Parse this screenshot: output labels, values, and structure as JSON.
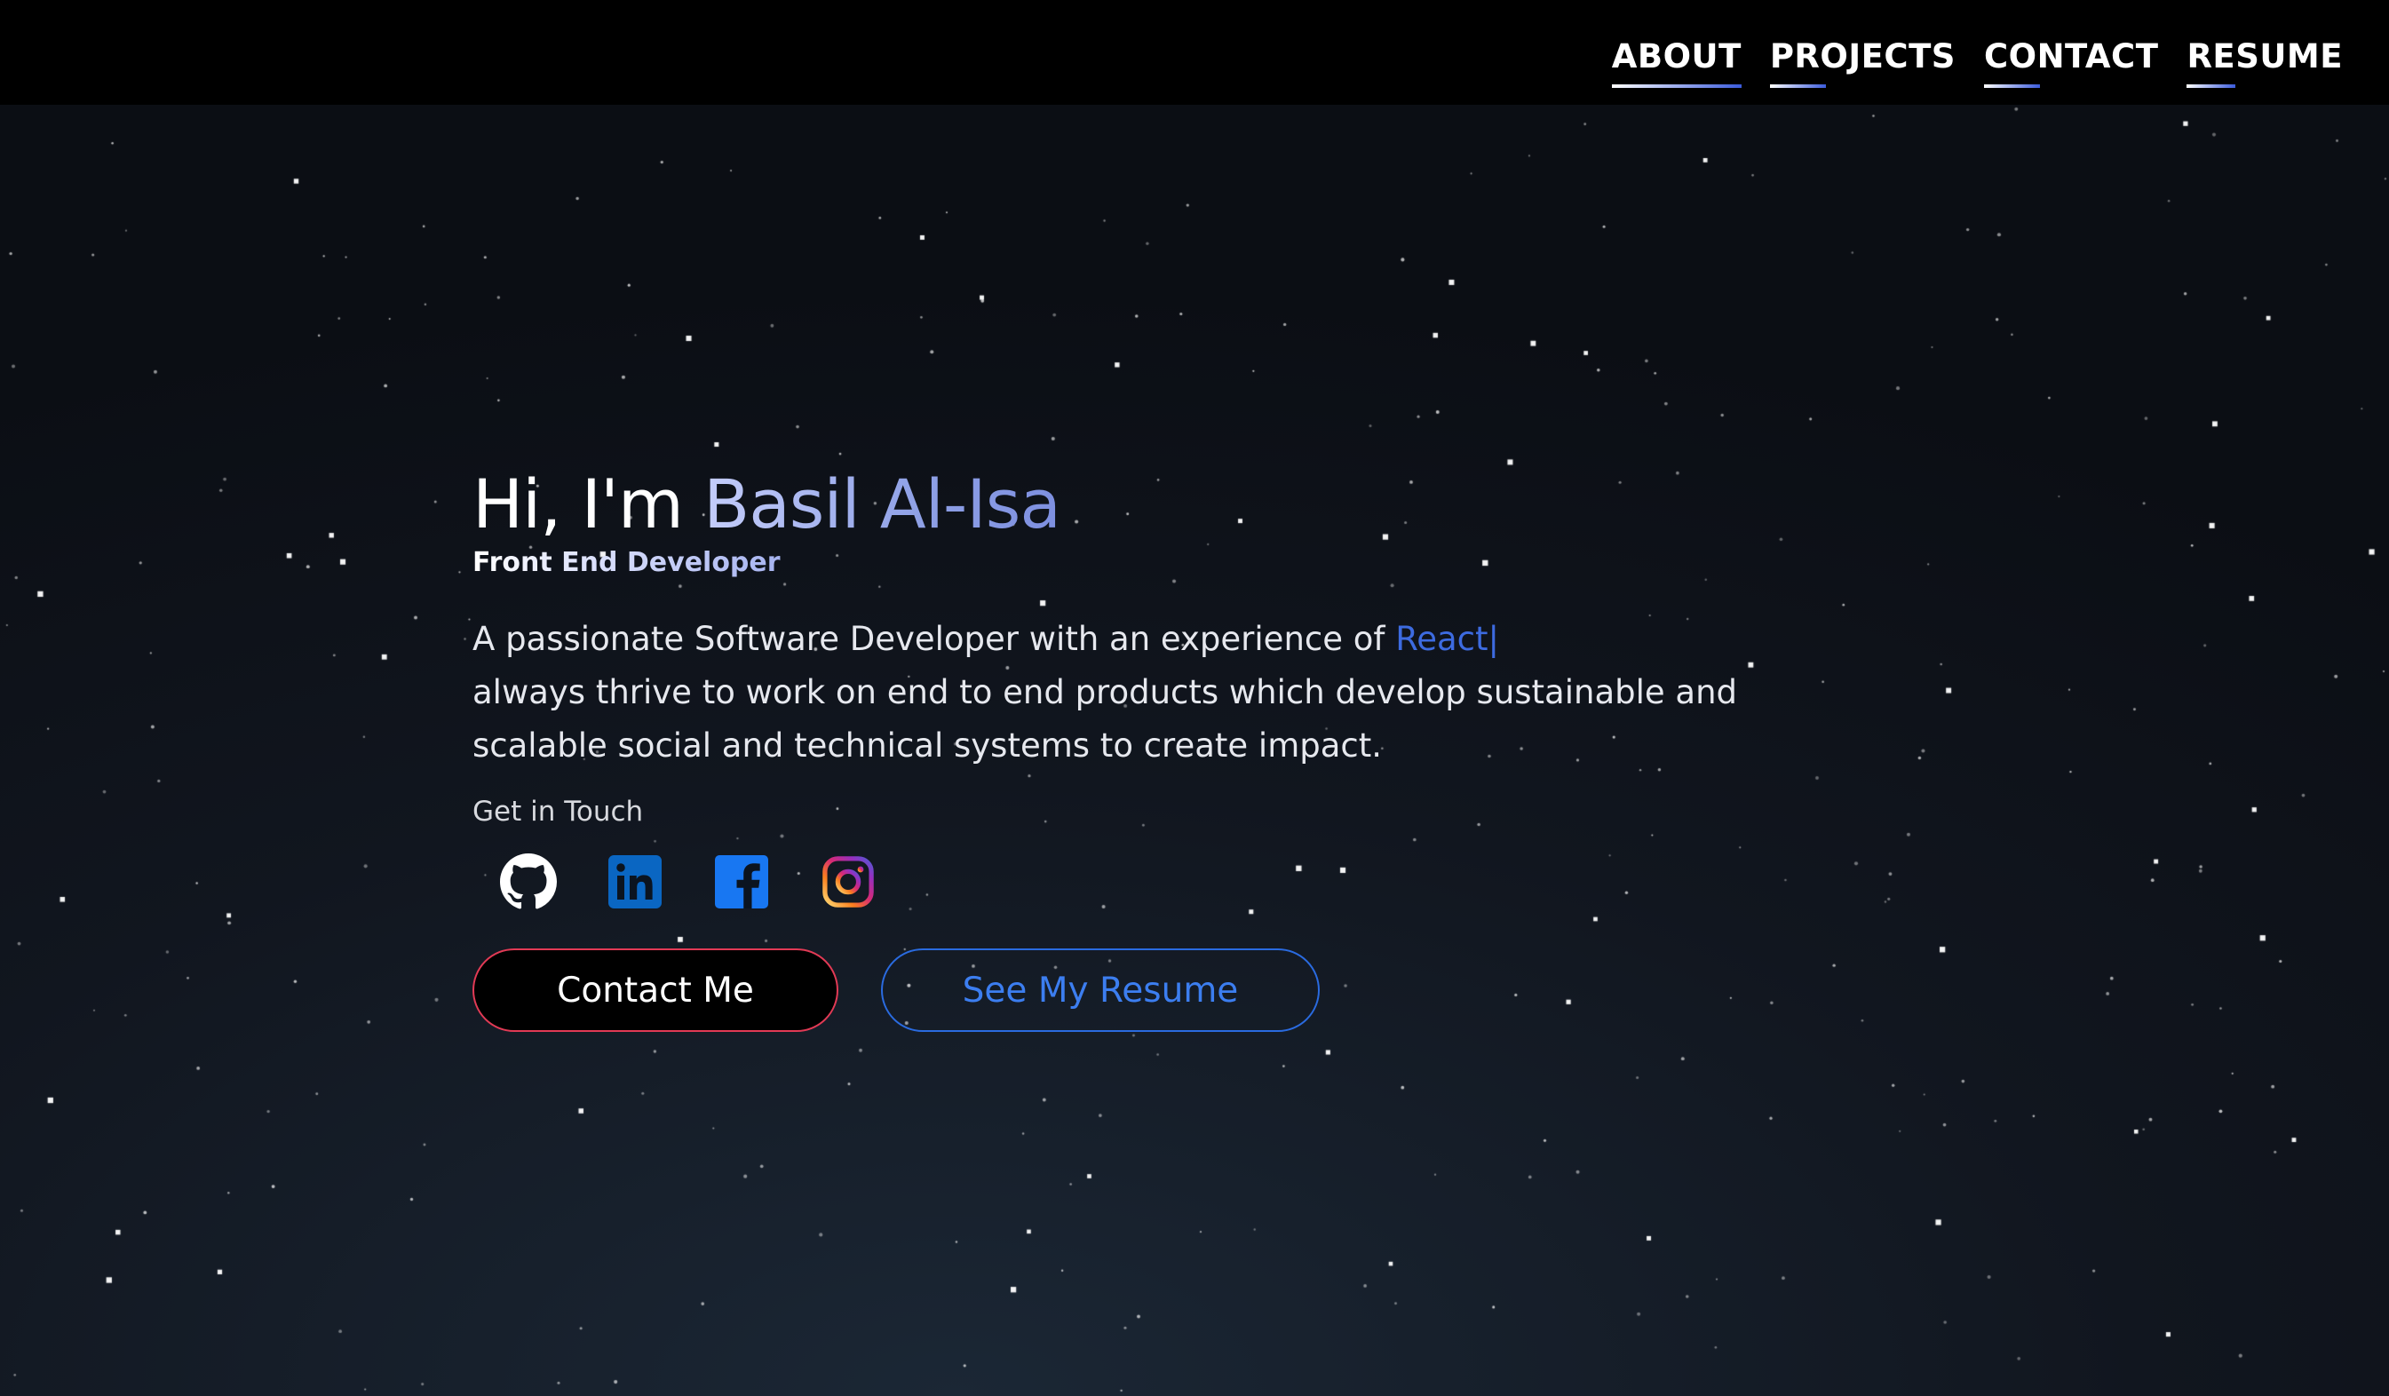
{
  "nav": {
    "items": [
      {
        "label": "ABOUT"
      },
      {
        "label": "PROJECTS"
      },
      {
        "label": "CONTACT"
      },
      {
        "label": "RESUME"
      }
    ]
  },
  "hero": {
    "greeting_prefix": "Hi, I'm ",
    "name": "Basil Al-Isa",
    "role": "Front End Developer",
    "description_prefix": "A passionate Software Developer with an experience of ",
    "typed_word": "React",
    "cursor": "|",
    "description_rest": "always thrive to work on end to end products which develop sustainable and scalable social and technical systems to create impact.",
    "get_in_touch": "Get in Touch"
  },
  "socials": [
    {
      "icon": "github-icon"
    },
    {
      "icon": "linkedin-icon"
    },
    {
      "icon": "facebook-icon"
    },
    {
      "icon": "instagram-icon"
    }
  ],
  "buttons": {
    "contact_label": "Contact Me",
    "resume_label": "See My Resume"
  },
  "colors": {
    "accent_blue": "#3d6be0",
    "contact_border": "#e23a55",
    "resume_border": "#2a6be0",
    "navbar_bg": "#000000",
    "linkedin": "#0a66c2",
    "facebook": "#1877f2"
  }
}
